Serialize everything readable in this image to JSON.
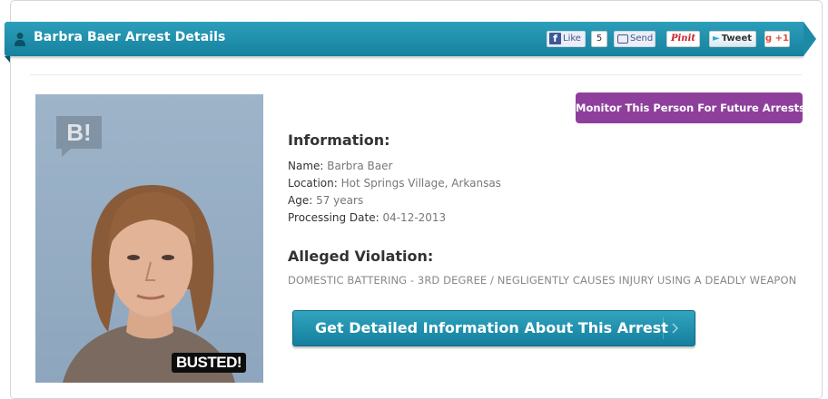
{
  "header": {
    "title": "Barbra Baer Arrest Details"
  },
  "social": {
    "like_label": "Like",
    "like_count": "5",
    "send_label": "Send",
    "pin_label": "Pinit",
    "tweet_label": "Tweet",
    "plus_label": "+1"
  },
  "photo": {
    "badge_text": "BUSTED!",
    "logo_text": "B!"
  },
  "monitor_button": "Monitor This Person For Future Arrests",
  "information": {
    "heading": "Information:",
    "name_label": "Name:",
    "name": "Barbra Baer",
    "location_label": "Location:",
    "location": "Hot Springs Village, Arkansas",
    "age_label": "Age:",
    "age": "57 years",
    "date_label": "Processing Date:",
    "date": "04-12-2013"
  },
  "violation": {
    "heading": "Alleged Violation:",
    "text": "DOMESTIC BATTERING - 3RD DEGREE / NEGLIGENTLY CAUSES INJURY USING A DEADLY WEAPON"
  },
  "detail_button": "Get Detailed Information About This Arrest",
  "colors": {
    "banner": "#1c8aa7",
    "monitor": "#8e3f9c",
    "button": "#1e8fae"
  }
}
